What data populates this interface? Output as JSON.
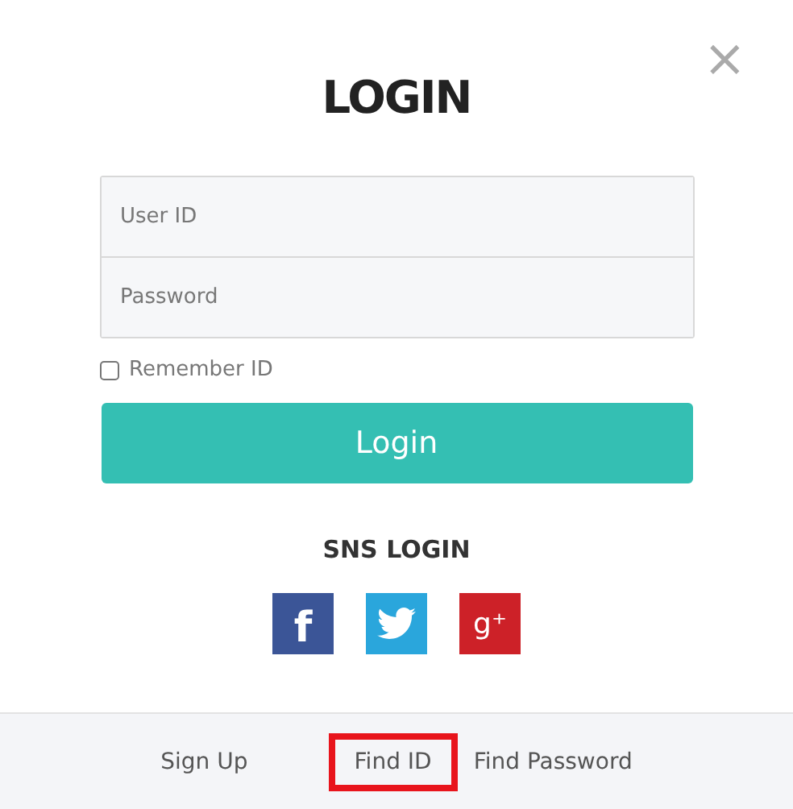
{
  "close": "×",
  "title": "LOGIN",
  "fields": [
    {
      "placeholder": "User ID"
    },
    {
      "placeholder": "Password"
    }
  ],
  "remember": {
    "label": "Remember ID",
    "checked": false
  },
  "submit": "Login",
  "sns": {
    "title": "SNS LOGIN",
    "buttons": [
      {
        "kind": "facebook",
        "glyph": "f"
      },
      {
        "kind": "twitter"
      },
      {
        "kind": "google",
        "glyph": "g⁺"
      }
    ]
  },
  "footer": [
    {
      "label": "Sign Up",
      "highlighted": false
    },
    {
      "label": "Find ID",
      "highlighted": true
    },
    {
      "label": "Find Password",
      "highlighted": false
    }
  ]
}
